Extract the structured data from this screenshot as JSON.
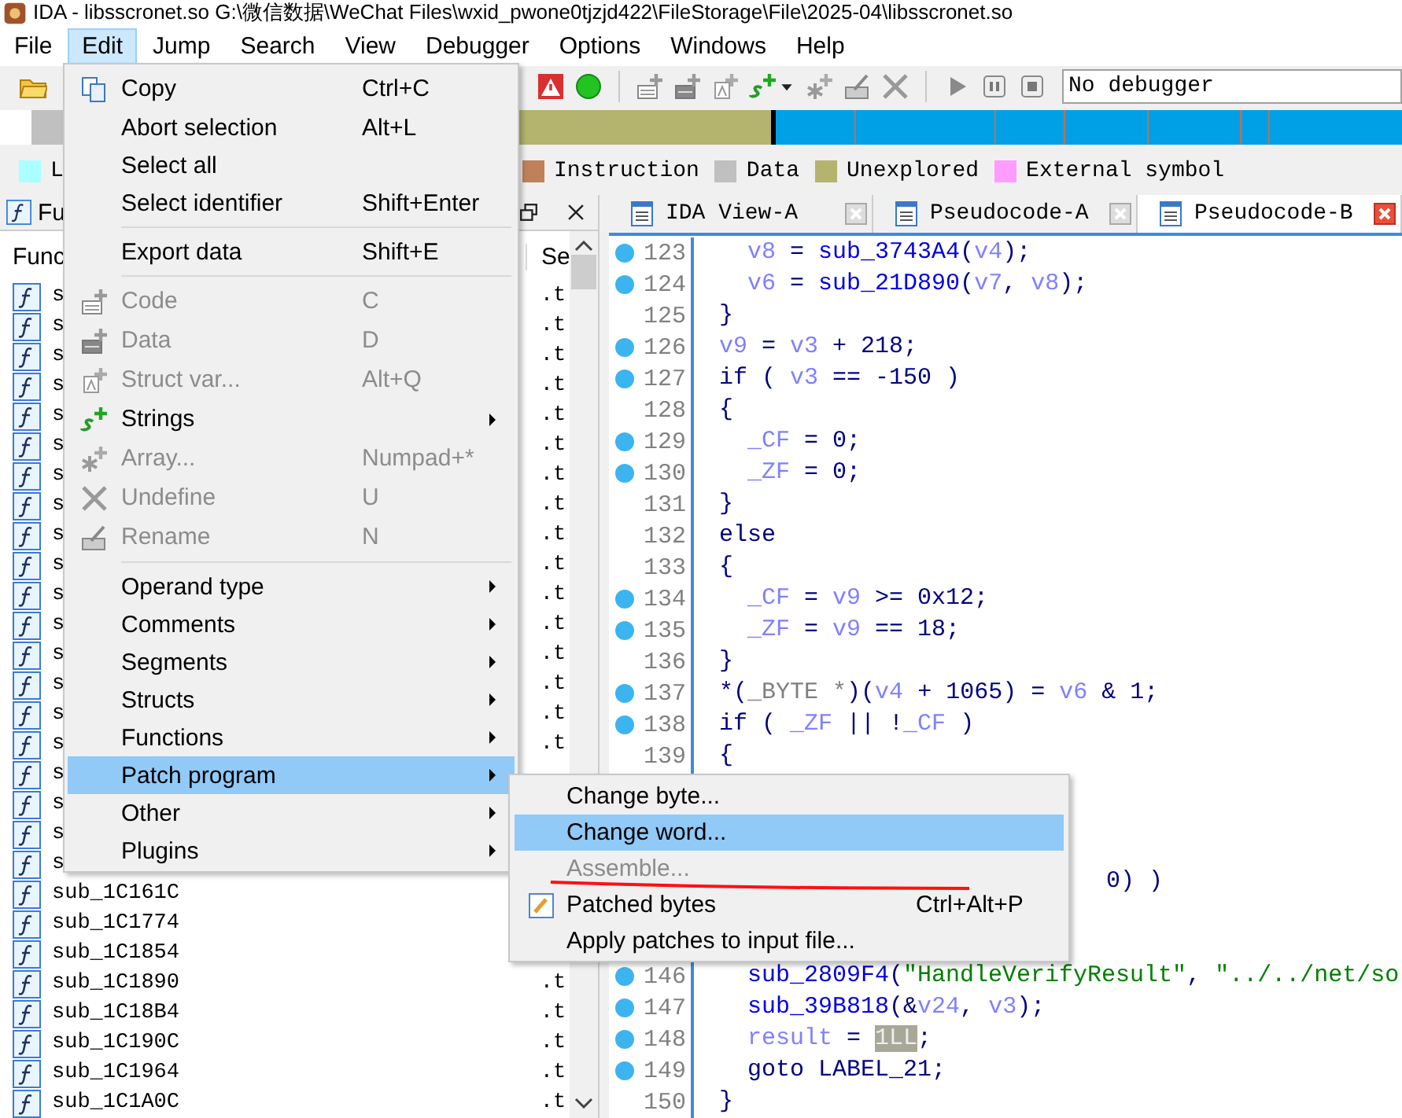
{
  "title": "IDA - libsscronet.so G:\\微信数据\\WeChat Files\\wxid_pwone0tjzjd422\\FileStorage\\File\\2025-04\\libsscronet.so",
  "menu_bar": [
    {
      "label": "File",
      "selected": false
    },
    {
      "label": "Edit",
      "selected": true
    },
    {
      "label": "Jump",
      "selected": false
    },
    {
      "label": "Search",
      "selected": false
    },
    {
      "label": "View",
      "selected": false
    },
    {
      "label": "Debugger",
      "selected": false
    },
    {
      "label": "Options",
      "selected": false
    },
    {
      "label": "Windows",
      "selected": false
    },
    {
      "label": "Help",
      "selected": false
    }
  ],
  "toolbar": {
    "debugger_field": "No debugger"
  },
  "legend": [
    {
      "label": "L",
      "color": "#aaffff"
    },
    {
      "label": "Instruction",
      "color": "#c0805a"
    },
    {
      "label": "Data",
      "color": "#c0c0c0"
    },
    {
      "label": "Unexplored",
      "color": "#b4b46e"
    },
    {
      "label": "External symbol",
      "color": "#ff9cff"
    }
  ],
  "functions_panel": {
    "tab": "Fu",
    "columns": [
      "Func",
      "Se"
    ],
    "rows": [
      {
        "name": "s",
        "segment": ".t"
      },
      {
        "name": "s",
        "segment": ".t"
      },
      {
        "name": "s",
        "segment": ".t"
      },
      {
        "name": "s",
        "segment": ".t"
      },
      {
        "name": "s",
        "segment": ".t"
      },
      {
        "name": "s",
        "segment": ".t"
      },
      {
        "name": "s",
        "segment": ".t"
      },
      {
        "name": "s",
        "segment": ".t"
      },
      {
        "name": "s",
        "segment": ".t"
      },
      {
        "name": "s",
        "segment": ".t"
      },
      {
        "name": "s",
        "segment": ".t"
      },
      {
        "name": "s",
        "segment": ".t"
      },
      {
        "name": "s",
        "segment": ".t"
      },
      {
        "name": "s",
        "segment": ".t"
      },
      {
        "name": "s",
        "segment": ".t"
      },
      {
        "name": "s",
        "segment": ".t"
      },
      {
        "name": "s"
      },
      {
        "name": "s"
      },
      {
        "name": "s"
      },
      {
        "name": "s"
      },
      {
        "name": "sub_1C161C"
      },
      {
        "name": "sub_1C1774"
      },
      {
        "name": "sub_1C1854"
      },
      {
        "name": "sub_1C1890",
        "segment": ".t"
      },
      {
        "name": "sub_1C18B4",
        "segment": ".t"
      },
      {
        "name": "sub_1C190C",
        "segment": ".t"
      },
      {
        "name": "sub_1C1964",
        "segment": ".t"
      },
      {
        "name": "sub_1C1A0C",
        "segment": ".t"
      }
    ]
  },
  "editor": {
    "tabs": [
      {
        "label": "IDA View-A",
        "selected": false
      },
      {
        "label": "Pseudocode-A",
        "selected": false
      },
      {
        "label": "Pseudocode-B",
        "selected": true
      }
    ],
    "lines": [
      {
        "kind": "code",
        "number": "123",
        "marker": true,
        "indent": true,
        "segments": [
          {
            "kind": "var",
            "text": "v8"
          },
          {
            "kind": "plain",
            "text": " = "
          },
          {
            "kind": "fn",
            "text": "sub_3743A4"
          },
          {
            "kind": "plain",
            "text": "("
          },
          {
            "kind": "var",
            "text": "v4"
          },
          {
            "kind": "plain",
            "text": ");"
          }
        ]
      },
      {
        "kind": "code",
        "number": "124",
        "marker": true,
        "indent": true,
        "segments": [
          {
            "kind": "var",
            "text": "v6"
          },
          {
            "kind": "plain",
            "text": " = "
          },
          {
            "kind": "fn",
            "text": "sub_21D890"
          },
          {
            "kind": "plain",
            "text": "("
          },
          {
            "kind": "var",
            "text": "v7"
          },
          {
            "kind": "plain",
            "text": ", "
          },
          {
            "kind": "var",
            "text": "v8"
          },
          {
            "kind": "plain",
            "text": ");"
          }
        ]
      },
      {
        "kind": "code",
        "number": "125",
        "marker": false,
        "segments": [
          {
            "kind": "plain",
            "text": "}"
          }
        ]
      },
      {
        "kind": "code",
        "number": "126",
        "marker": true,
        "segments": [
          {
            "kind": "var",
            "text": "v9"
          },
          {
            "kind": "plain",
            "text": " = "
          },
          {
            "kind": "var",
            "text": "v3"
          },
          {
            "kind": "plain",
            "text": " + 218;"
          }
        ]
      },
      {
        "kind": "code",
        "number": "127",
        "marker": true,
        "segments": [
          {
            "kind": "plain",
            "text": "if ( "
          },
          {
            "kind": "var",
            "text": "v3"
          },
          {
            "kind": "plain",
            "text": " == -150 )"
          }
        ]
      },
      {
        "kind": "code",
        "number": "128",
        "marker": false,
        "segments": [
          {
            "kind": "plain",
            "text": "{"
          }
        ]
      },
      {
        "kind": "code",
        "number": "129",
        "marker": true,
        "indent": true,
        "segments": [
          {
            "kind": "var",
            "text": "_CF"
          },
          {
            "kind": "plain",
            "text": " = 0;"
          }
        ]
      },
      {
        "kind": "code",
        "number": "130",
        "marker": true,
        "indent": true,
        "segments": [
          {
            "kind": "var",
            "text": "_ZF"
          },
          {
            "kind": "plain",
            "text": " = 0;"
          }
        ]
      },
      {
        "kind": "code",
        "number": "131",
        "marker": false,
        "segments": [
          {
            "kind": "plain",
            "text": "}"
          }
        ]
      },
      {
        "kind": "code",
        "number": "132",
        "marker": false,
        "segments": [
          {
            "kind": "plain",
            "text": "else"
          }
        ]
      },
      {
        "kind": "code",
        "number": "133",
        "marker": false,
        "segments": [
          {
            "kind": "plain",
            "text": "{"
          }
        ]
      },
      {
        "kind": "code",
        "number": "134",
        "marker": true,
        "indent": true,
        "segments": [
          {
            "kind": "var",
            "text": "_CF"
          },
          {
            "kind": "plain",
            "text": " = "
          },
          {
            "kind": "var",
            "text": "v9"
          },
          {
            "kind": "plain",
            "text": " >= 0x12;"
          }
        ]
      },
      {
        "kind": "code",
        "number": "135",
        "marker": true,
        "indent": true,
        "segments": [
          {
            "kind": "var",
            "text": "_ZF"
          },
          {
            "kind": "plain",
            "text": " = "
          },
          {
            "kind": "var",
            "text": "v9"
          },
          {
            "kind": "plain",
            "text": " == 18;"
          }
        ]
      },
      {
        "kind": "code",
        "number": "136",
        "marker": false,
        "segments": [
          {
            "kind": "plain",
            "text": "}"
          }
        ]
      },
      {
        "kind": "code",
        "number": "137",
        "marker": true,
        "segments": [
          {
            "kind": "plain",
            "text": "*("
          },
          {
            "kind": "type",
            "text": "_BYTE *"
          },
          {
            "kind": "plain",
            "text": ")("
          },
          {
            "kind": "var",
            "text": "v4"
          },
          {
            "kind": "plain",
            "text": " + 1065) = "
          },
          {
            "kind": "var",
            "text": "v6"
          },
          {
            "kind": "plain",
            "text": " & 1;"
          }
        ]
      },
      {
        "kind": "code",
        "number": "138",
        "marker": true,
        "segments": [
          {
            "kind": "plain",
            "text": "if ( "
          },
          {
            "kind": "var",
            "text": "_ZF"
          },
          {
            "kind": "plain",
            "text": " || !"
          },
          {
            "kind": "var",
            "text": "_CF"
          },
          {
            "kind": "plain",
            "text": " )"
          }
        ]
      },
      {
        "kind": "code",
        "number": "139",
        "marker": false,
        "segments": [
          {
            "kind": "plain",
            "text": "{"
          }
        ]
      },
      {
        "kind": "covered"
      },
      {
        "kind": "covered"
      },
      {
        "kind": "covered"
      },
      {
        "kind": "covered",
        "segments": [
          {
            "kind": "plain",
            "text": "0) )"
          }
        ]
      },
      {
        "kind": "covered"
      },
      {
        "kind": "covered"
      },
      {
        "kind": "code",
        "number": "146",
        "marker": true,
        "indent": true,
        "segments": [
          {
            "kind": "fn",
            "text": "sub_2809F4"
          },
          {
            "kind": "plain",
            "text": "("
          },
          {
            "kind": "str",
            "text": "\"HandleVerifyResult\""
          },
          {
            "kind": "plain",
            "text": ", "
          },
          {
            "kind": "str",
            "text": "\"../../net/so"
          }
        ]
      },
      {
        "kind": "code",
        "number": "147",
        "marker": true,
        "indent": true,
        "segments": [
          {
            "kind": "fn",
            "text": "sub_39B818"
          },
          {
            "kind": "plain",
            "text": "(&"
          },
          {
            "kind": "var",
            "text": "v24"
          },
          {
            "kind": "plain",
            "text": ", "
          },
          {
            "kind": "var",
            "text": "v3"
          },
          {
            "kind": "plain",
            "text": ");"
          }
        ]
      },
      {
        "kind": "code",
        "number": "148",
        "marker": true,
        "indent": true,
        "segments": [
          {
            "kind": "var",
            "text": "result"
          },
          {
            "kind": "plain",
            "text": " = "
          },
          {
            "kind": "hl",
            "text": "1LL"
          },
          {
            "kind": "plain",
            "text": ";"
          }
        ]
      },
      {
        "kind": "code",
        "number": "149",
        "marker": true,
        "indent": true,
        "segments": [
          {
            "kind": "plain",
            "text": "goto LABEL_21;"
          }
        ]
      },
      {
        "kind": "code",
        "number": "150",
        "marker": false,
        "segments": [
          {
            "kind": "plain",
            "text": "}"
          }
        ]
      }
    ]
  },
  "edit_menu": {
    "items": [
      {
        "kind": "item",
        "label": "Copy",
        "shortcut": "Ctrl+C",
        "disabled": false,
        "selected": false,
        "submenu": false
      },
      {
        "kind": "item",
        "label": "Abort selection",
        "shortcut": "Alt+L",
        "disabled": false,
        "selected": false,
        "submenu": false
      },
      {
        "kind": "item",
        "label": "Select all",
        "disabled": false,
        "selected": false,
        "submenu": false
      },
      {
        "kind": "item",
        "label": "Select identifier",
        "shortcut": "Shift+Enter",
        "disabled": false,
        "selected": false,
        "submenu": false
      },
      {
        "kind": "separator"
      },
      {
        "kind": "item",
        "label": "Export data",
        "shortcut": "Shift+E",
        "disabled": false,
        "selected": false,
        "submenu": false
      },
      {
        "kind": "separator"
      },
      {
        "kind": "item",
        "label": "Code",
        "shortcut": "C",
        "disabled": true,
        "selected": false,
        "submenu": false
      },
      {
        "kind": "item",
        "label": "Data",
        "shortcut": "D",
        "disabled": true,
        "selected": false,
        "submenu": false
      },
      {
        "kind": "item",
        "label": "Struct var...",
        "shortcut": "Alt+Q",
        "disabled": true,
        "selected": false,
        "submenu": false
      },
      {
        "kind": "item",
        "label": "Strings",
        "disabled": false,
        "selected": false,
        "submenu": true
      },
      {
        "kind": "item",
        "label": "Array...",
        "shortcut": "Numpad+*",
        "disabled": true,
        "selected": false,
        "submenu": false
      },
      {
        "kind": "item",
        "label": "Undefine",
        "shortcut": "U",
        "disabled": true,
        "selected": false,
        "submenu": false
      },
      {
        "kind": "item",
        "label": "Rename",
        "shortcut": "N",
        "disabled": true,
        "selected": false,
        "submenu": false
      },
      {
        "kind": "separator"
      },
      {
        "kind": "item",
        "label": "Operand type",
        "disabled": false,
        "selected": false,
        "submenu": true
      },
      {
        "kind": "item",
        "label": "Comments",
        "disabled": false,
        "selected": false,
        "submenu": true
      },
      {
        "kind": "item",
        "label": "Segments",
        "disabled": false,
        "selected": false,
        "submenu": true
      },
      {
        "kind": "item",
        "label": "Structs",
        "disabled": false,
        "selected": false,
        "submenu": true
      },
      {
        "kind": "item",
        "label": "Functions",
        "disabled": false,
        "selected": false,
        "submenu": true
      },
      {
        "kind": "item",
        "label": "Patch program",
        "disabled": false,
        "selected": true,
        "submenu": true
      },
      {
        "kind": "item",
        "label": "Other",
        "disabled": false,
        "selected": false,
        "submenu": true
      },
      {
        "kind": "item",
        "label": "Plugins",
        "disabled": false,
        "selected": false,
        "submenu": true
      }
    ]
  },
  "patch_submenu": {
    "items": [
      {
        "label": "Change byte...",
        "disabled": false,
        "selected": false
      },
      {
        "label": "Change word...",
        "disabled": false,
        "selected": true
      },
      {
        "label": "Assemble...",
        "disabled": true,
        "selected": false
      },
      {
        "label": "Patched bytes",
        "shortcut": "Ctrl+Alt+P",
        "disabled": false,
        "selected": false
      },
      {
        "label": "Apply patches to input file...",
        "disabled": false,
        "selected": false
      }
    ]
  }
}
